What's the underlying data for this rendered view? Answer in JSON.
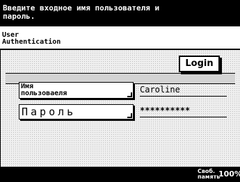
{
  "header": {
    "message_line1": "Введите входное имя пользователя и",
    "message_line2": "пароль."
  },
  "title": {
    "line1": "User",
    "line2": "Authentication"
  },
  "login_button_label": "Login",
  "user_field": {
    "button_line1": "Имя",
    "button_line2": "пользоваеля",
    "value": "Caroline"
  },
  "password_field": {
    "button_label": "Пароль",
    "value": "**********"
  },
  "footer": {
    "memory_label_line1": "Своб.",
    "memory_label_line2": "память",
    "memory_value": "100%"
  }
}
